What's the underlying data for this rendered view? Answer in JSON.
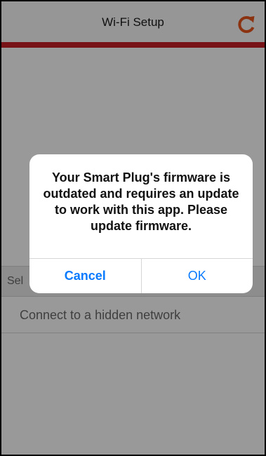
{
  "header": {
    "title": "Wi-Fi Setup",
    "refresh_icon": "refresh-icon",
    "accent_color": "#c62127"
  },
  "list": {
    "section_header": "Sel",
    "hidden_network_label": "Connect to a hidden network"
  },
  "alert": {
    "message": "Your Smart Plug's firmware is outdated and requires an update to work with this app. Please update firmware.",
    "cancel_label": "Cancel",
    "ok_label": "OK",
    "button_color": "#0a7aff"
  }
}
